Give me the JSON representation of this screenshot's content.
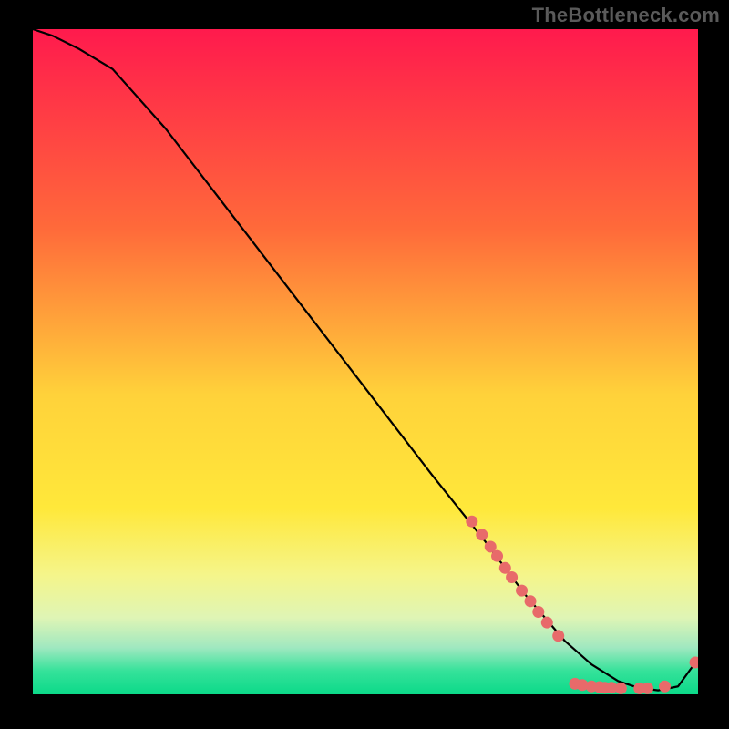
{
  "attribution": "TheBottleneck.com",
  "chart_data": {
    "type": "line",
    "title": "",
    "xlabel": "",
    "ylabel": "",
    "xlim": [
      0,
      100
    ],
    "ylim": [
      0,
      100
    ],
    "background_gradient": {
      "stops": [
        {
          "offset": 0.0,
          "color": "#ff1a4d"
        },
        {
          "offset": 0.3,
          "color": "#ff6a3a"
        },
        {
          "offset": 0.55,
          "color": "#ffd23a"
        },
        {
          "offset": 0.72,
          "color": "#ffe83a"
        },
        {
          "offset": 0.82,
          "color": "#f5f58a"
        },
        {
          "offset": 0.885,
          "color": "#dff5b5"
        },
        {
          "offset": 0.93,
          "color": "#9fe8c0"
        },
        {
          "offset": 0.965,
          "color": "#35e29a"
        },
        {
          "offset": 1.0,
          "color": "#0bd989"
        }
      ]
    },
    "series": [
      {
        "name": "bottleneck-curve",
        "x": [
          0,
          3,
          7,
          12,
          20,
          30,
          40,
          50,
          60,
          68,
          74,
          80,
          84,
          88,
          91,
          94,
          97,
          99.6
        ],
        "y": [
          100,
          99,
          97,
          94,
          85,
          72,
          59,
          46,
          33,
          23,
          15,
          8,
          4.5,
          2,
          1,
          0.6,
          1.2,
          4.8
        ],
        "stroke": "#000000",
        "stroke_width": 2.2
      }
    ],
    "markers": [
      {
        "name": "highlighted-points",
        "color": "#e86a6a",
        "radius": 6.5,
        "points": [
          {
            "x": 66.0,
            "y": 26.0
          },
          {
            "x": 67.5,
            "y": 24.0
          },
          {
            "x": 68.8,
            "y": 22.2
          },
          {
            "x": 69.8,
            "y": 20.8
          },
          {
            "x": 71.0,
            "y": 19.0
          },
          {
            "x": 72.0,
            "y": 17.6
          },
          {
            "x": 73.5,
            "y": 15.6
          },
          {
            "x": 74.8,
            "y": 14.0
          },
          {
            "x": 76.0,
            "y": 12.4
          },
          {
            "x": 77.3,
            "y": 10.8
          },
          {
            "x": 79.0,
            "y": 8.8
          },
          {
            "x": 81.5,
            "y": 1.6
          },
          {
            "x": 82.6,
            "y": 1.4
          },
          {
            "x": 84.0,
            "y": 1.2
          },
          {
            "x": 85.2,
            "y": 1.1
          },
          {
            "x": 86.0,
            "y": 1.0
          },
          {
            "x": 87.0,
            "y": 1.0
          },
          {
            "x": 88.4,
            "y": 0.9
          },
          {
            "x": 91.2,
            "y": 0.9
          },
          {
            "x": 92.4,
            "y": 0.9
          },
          {
            "x": 95.0,
            "y": 1.2
          },
          {
            "x": 99.6,
            "y": 4.8
          }
        ]
      }
    ]
  }
}
